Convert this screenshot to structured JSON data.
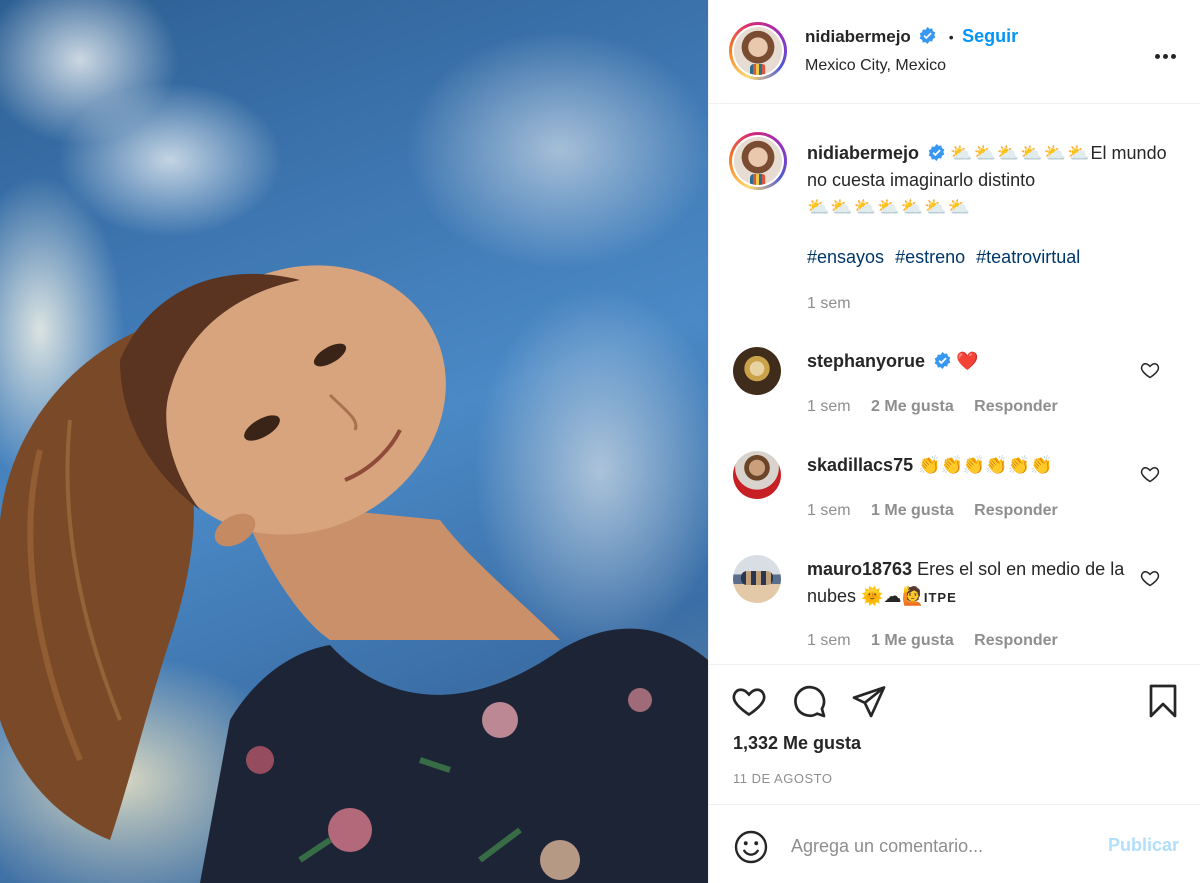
{
  "post": {
    "author": {
      "username": "nidiabermejo",
      "verified": true,
      "follow_label": "Seguir",
      "location": "Mexico City, Mexico"
    },
    "caption": {
      "leading_emojis": "⛅⛅⛅⛅⛅⛅",
      "text": "El mundo no cuesta imaginarlo distinto",
      "trailing_emojis": "⛅⛅⛅⛅⛅⛅⛅",
      "hashtags": [
        "#ensayos",
        "#estreno",
        "#teatrovirtual"
      ],
      "time": "1 sem"
    },
    "comments": [
      {
        "username": "stephanyorue",
        "verified": true,
        "text": "❤️",
        "time": "1 sem",
        "likes": "2 Me gusta",
        "reply": "Responder"
      },
      {
        "username": "skadillacs75",
        "verified": false,
        "text": "👏👏👏👏👏👏",
        "time": "1 sem",
        "likes": "1 Me gusta",
        "reply": "Responder"
      },
      {
        "username": "mauro18763",
        "verified": false,
        "text": "Eres el sol en medio de la nubes 🌞☁🙋",
        "suffix": "ITPE",
        "time": "1 sem",
        "likes": "1 Me gusta",
        "reply": "Responder"
      }
    ],
    "likes_count": "1,332 Me gusta",
    "date": "11 DE AGOSTO",
    "add_comment": {
      "placeholder": "Agrega un comentario...",
      "publish_label": "Publicar"
    }
  },
  "colors": {
    "accent": "#0095f6",
    "hashtag": "#00376b",
    "muted": "#8e8e8e",
    "publish_disabled": "#b2dffc",
    "heart": "#ed4956"
  },
  "icons": [
    "verified-badge-icon",
    "more-options-icon",
    "heart-outline-icon",
    "comment-icon",
    "share-icon",
    "save-bookmark-icon",
    "emoji-smile-icon"
  ]
}
